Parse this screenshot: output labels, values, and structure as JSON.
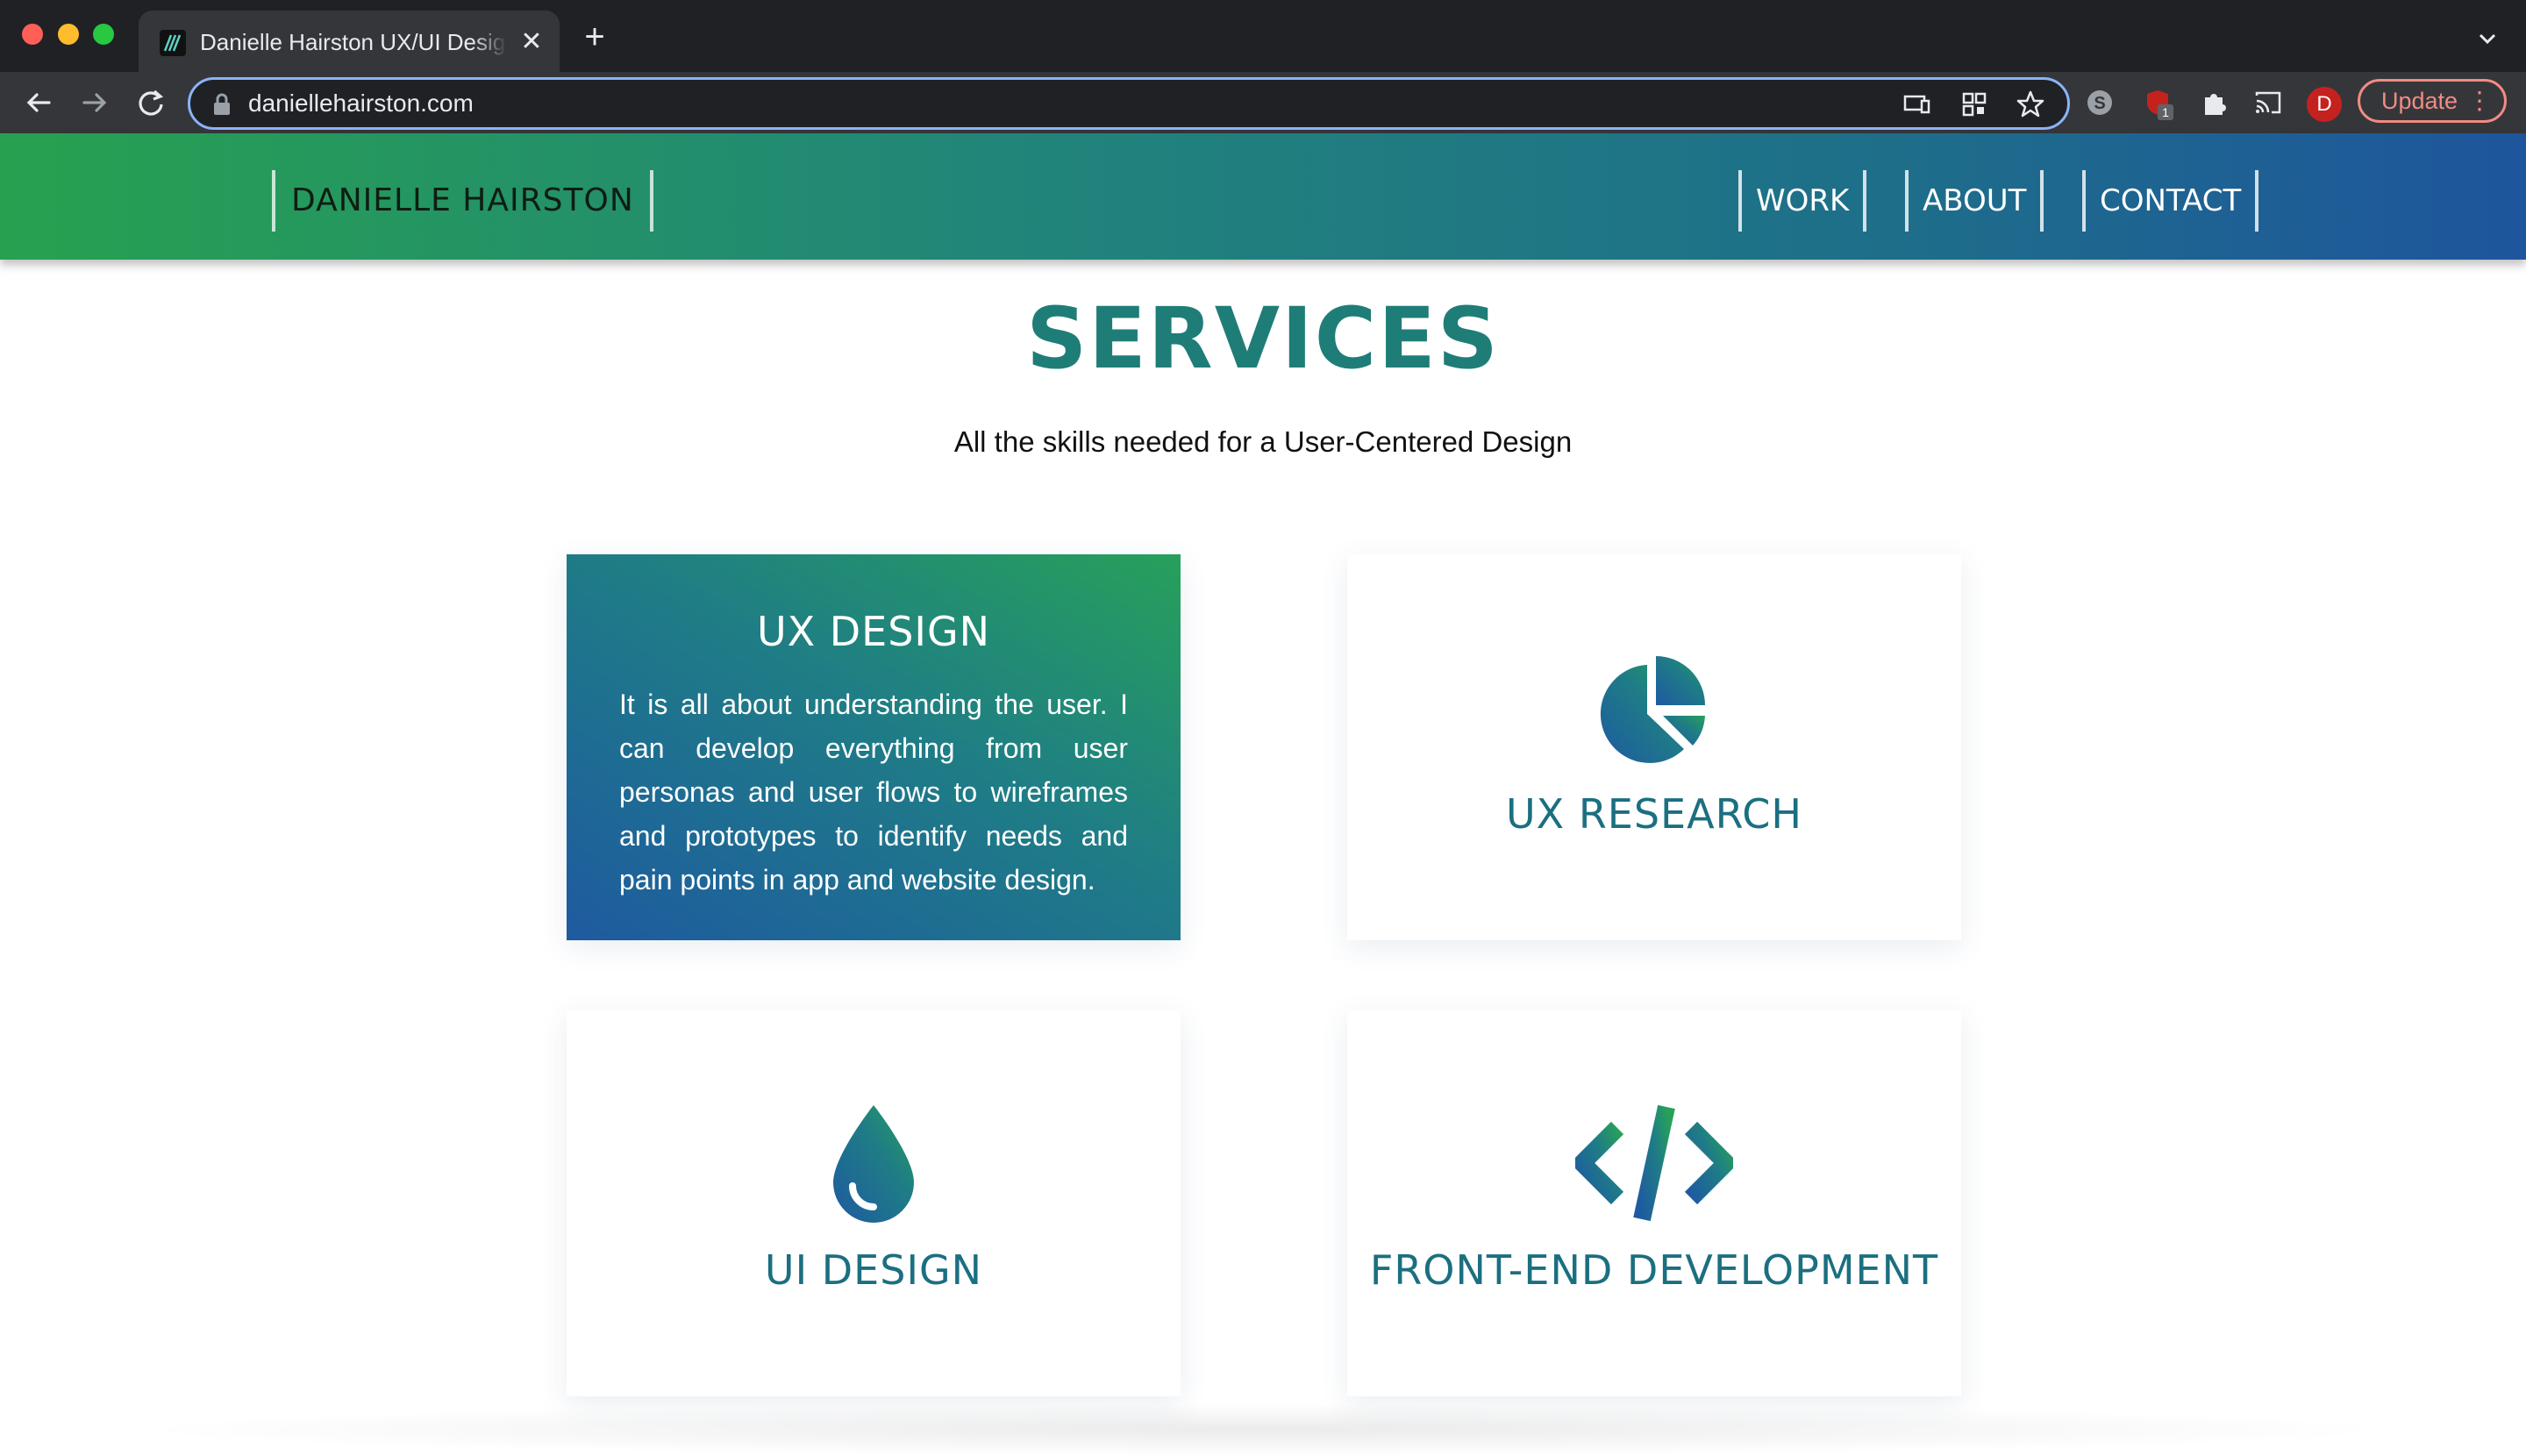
{
  "browser": {
    "tab_title": "Danielle Hairston UX/UI Design",
    "tab_close": "✕",
    "new_tab": "+",
    "url": "daniellehairston.com",
    "extension_badge": "1",
    "profile_initial": "D",
    "update_label": "Update",
    "menu_dots": "⋮",
    "icons": [
      "back-icon",
      "forward-icon",
      "reload-icon",
      "lock-icon",
      "cast-page-icon",
      "qr-code-icon",
      "bookmark-star-icon",
      "skype-extension-icon",
      "ublock-extension-icon",
      "extensions-puzzle-icon",
      "cast-icon",
      "tab-search-icon"
    ]
  },
  "site": {
    "brand": "DANIELLE HAIRSTON",
    "nav": {
      "work": "WORK",
      "about": "ABOUT",
      "contact": "CONTACT"
    },
    "colors": {
      "accent": "#1f7d78",
      "gradient_start": "#27a150",
      "gradient_end": "#1e559c"
    }
  },
  "services": {
    "title": "SERVICES",
    "subtitle": "All the skills needed for a User-Centered Design",
    "cards": [
      {
        "heading": "UX DESIGN",
        "description": "It is all about understanding the user. I can develop everything from user personas and user flows to wireframes and prototypes to identify needs and pain points in app and website design.",
        "active": true
      },
      {
        "heading": "UX RESEARCH",
        "icon": "pie-chart-icon"
      },
      {
        "heading": "UI DESIGN",
        "icon": "droplet-icon"
      },
      {
        "heading": "FRONT-END DEVELOPMENT",
        "icon": "code-icon"
      }
    ]
  }
}
